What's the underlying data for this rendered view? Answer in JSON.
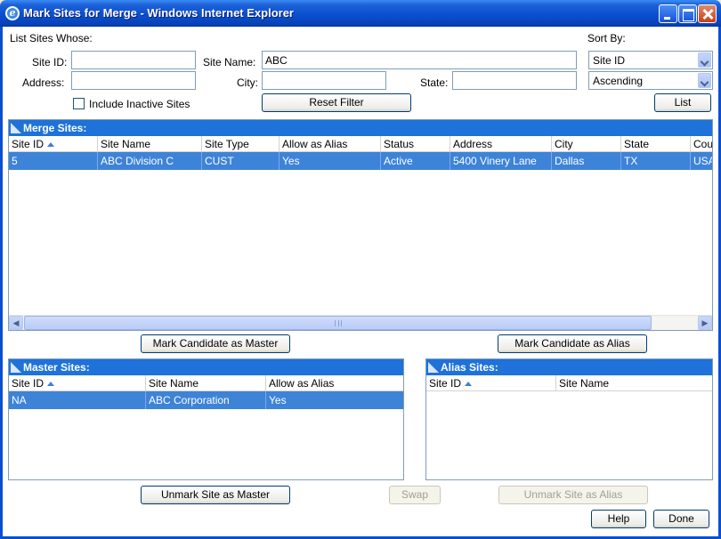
{
  "window": {
    "title": "Mark Sites for Merge - Windows Internet Explorer",
    "icon": "ie-icon"
  },
  "filter": {
    "heading": "List Sites Whose:",
    "site_id_label": "Site ID:",
    "site_id_value": "",
    "site_name_label": "Site Name:",
    "site_name_value": "ABC",
    "address_label": "Address:",
    "address_value": "",
    "city_label": "City:",
    "city_value": "",
    "state_label": "State:",
    "state_value": "",
    "include_inactive_label": "Include Inactive Sites",
    "include_inactive_checked": false,
    "reset_label": "Reset Filter"
  },
  "sort": {
    "label": "Sort By:",
    "field": "Site ID",
    "direction": "Ascending",
    "list_label": "List"
  },
  "merge_sites": {
    "title": "Merge Sites:",
    "columns": [
      "Site ID",
      "Site Name",
      "Site Type",
      "Allow as Alias",
      "Status",
      "Address",
      "City",
      "State",
      "Cou"
    ],
    "rows": [
      [
        "5",
        "ABC Division C",
        "CUST",
        "Yes",
        "Active",
        "5400 Vinery Lane",
        "Dallas",
        "TX",
        "USA"
      ]
    ],
    "scroll_grip": "III"
  },
  "actions": {
    "mark_master": "Mark Candidate as Master",
    "mark_alias": "Mark Candidate as Alias",
    "unmark_master": "Unmark Site as Master",
    "swap": "Swap",
    "unmark_alias": "Unmark Site as Alias",
    "help": "Help",
    "done": "Done"
  },
  "master_sites": {
    "title": "Master Sites:",
    "columns": [
      "Site ID",
      "Site Name",
      "Allow as Alias"
    ],
    "rows": [
      [
        "NA",
        "ABC Corporation",
        "Yes"
      ]
    ]
  },
  "alias_sites": {
    "title": "Alias Sites:",
    "columns": [
      "Site ID",
      "Site Name"
    ],
    "rows": []
  }
}
